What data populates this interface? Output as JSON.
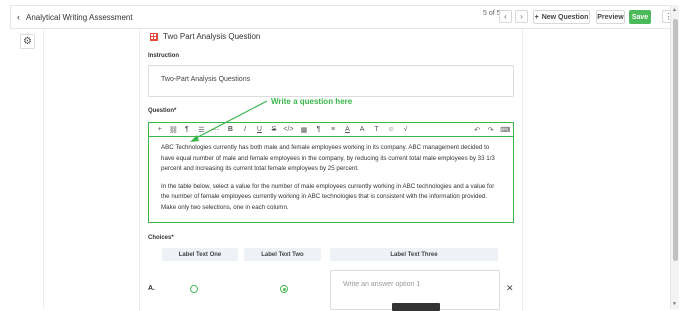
{
  "header": {
    "back_label": "Analytical Writing Assessment",
    "pager": "5 of 5",
    "new_question_label": "New Question",
    "preview_label": "Preview",
    "save_label": "Save"
  },
  "question_type": {
    "icon": "grid-icon",
    "label": "Two Part Analysis Question",
    "accent": "#e0493b"
  },
  "instruction": {
    "label": "Instruction",
    "value": "Two-Part Analysis Questions"
  },
  "question": {
    "label": "Question*",
    "annotation": "Write a question here",
    "annotation_color": "#3ab64a",
    "paragraphs": [
      "ABC Technologies currently has both male and female employees working in its company. ABC management decided to have equal number of male and female employees in the company, by reducing its current total male employees by 33 1/3 percent and increasing its current total female employees by 25 percent.",
      "In the table below, select a value for the number of male employees currently working in ABC technologies and a value for the number of female employees currently working in ABC technologies that is consistent with the information provided. Make only two selections, one in each column."
    ]
  },
  "choices": {
    "label": "Choices*",
    "columns": [
      "Label Text One",
      "Label Text Two",
      "Label Text Three"
    ],
    "rows": [
      {
        "label": "A.",
        "col1_selected": false,
        "col2_selected": true,
        "answer_placeholder": "Write an answer option 1"
      }
    ]
  },
  "colors": {
    "save": "#4cba5a",
    "border_active": "#3ab64a"
  }
}
